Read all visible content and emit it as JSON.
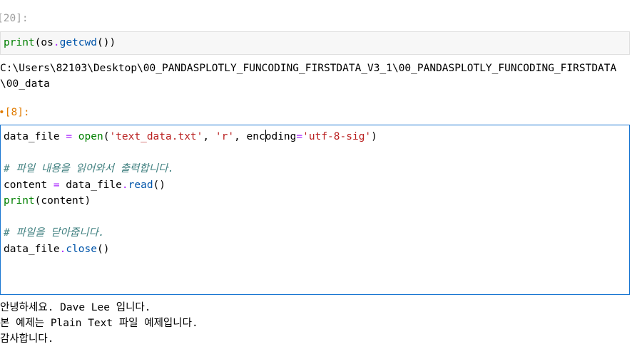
{
  "cell1": {
    "prompt": "[20]:",
    "code": {
      "print": "print",
      "open_paren": "(",
      "obj": "os",
      "dot": ".",
      "method": "getcwd",
      "close": "())"
    },
    "output": [
      "C:\\Users\\82103\\Desktop\\00_PANDASPLOTLY_FUNCODING_FIRSTDATA_V3_1\\00_PANDASPLOTLY_FUNCODING_FIRSTDATA",
      "\\00_data"
    ]
  },
  "cell2": {
    "prompt": "[8]:",
    "marker": "•",
    "lines": {
      "l1": {
        "var": "data_file ",
        "eq": "=",
        "sp": " ",
        "fn": "open",
        "p1": "(",
        "s1": "'text_data.txt'",
        "c1": ", ",
        "s2": "'r'",
        "c2": ", ",
        "kw_a": "enc",
        "kw_b": "oding",
        "eq2": "=",
        "s3": "'utf-8-sig'",
        "p2": ")"
      },
      "comment1": "# 파일 내용을 읽어와서 출력합니다.",
      "l3": {
        "var": "content ",
        "eq": "=",
        "rest_a": " data_file",
        "dot": ".",
        "method": "read",
        "paren": "()"
      },
      "l4": {
        "fn": "print",
        "rest": "(content)"
      },
      "comment2": "# 파일을 닫아줍니다.",
      "l6": {
        "obj": "data_file",
        "dot": ".",
        "method": "close",
        "paren": "()"
      }
    },
    "output": [
      "안녕하세요. Dave Lee 입니다.",
      "본 예제는 Plain Text 파일 예제입니다.",
      "감사합니다."
    ]
  },
  "colors": {
    "builtin": "#008000",
    "method": "#0055aa",
    "string": "#ba2121",
    "operator": "#aa22ff",
    "comment": "#408080",
    "active_prompt": "#e07b00",
    "selected_border": "#1976d2"
  }
}
